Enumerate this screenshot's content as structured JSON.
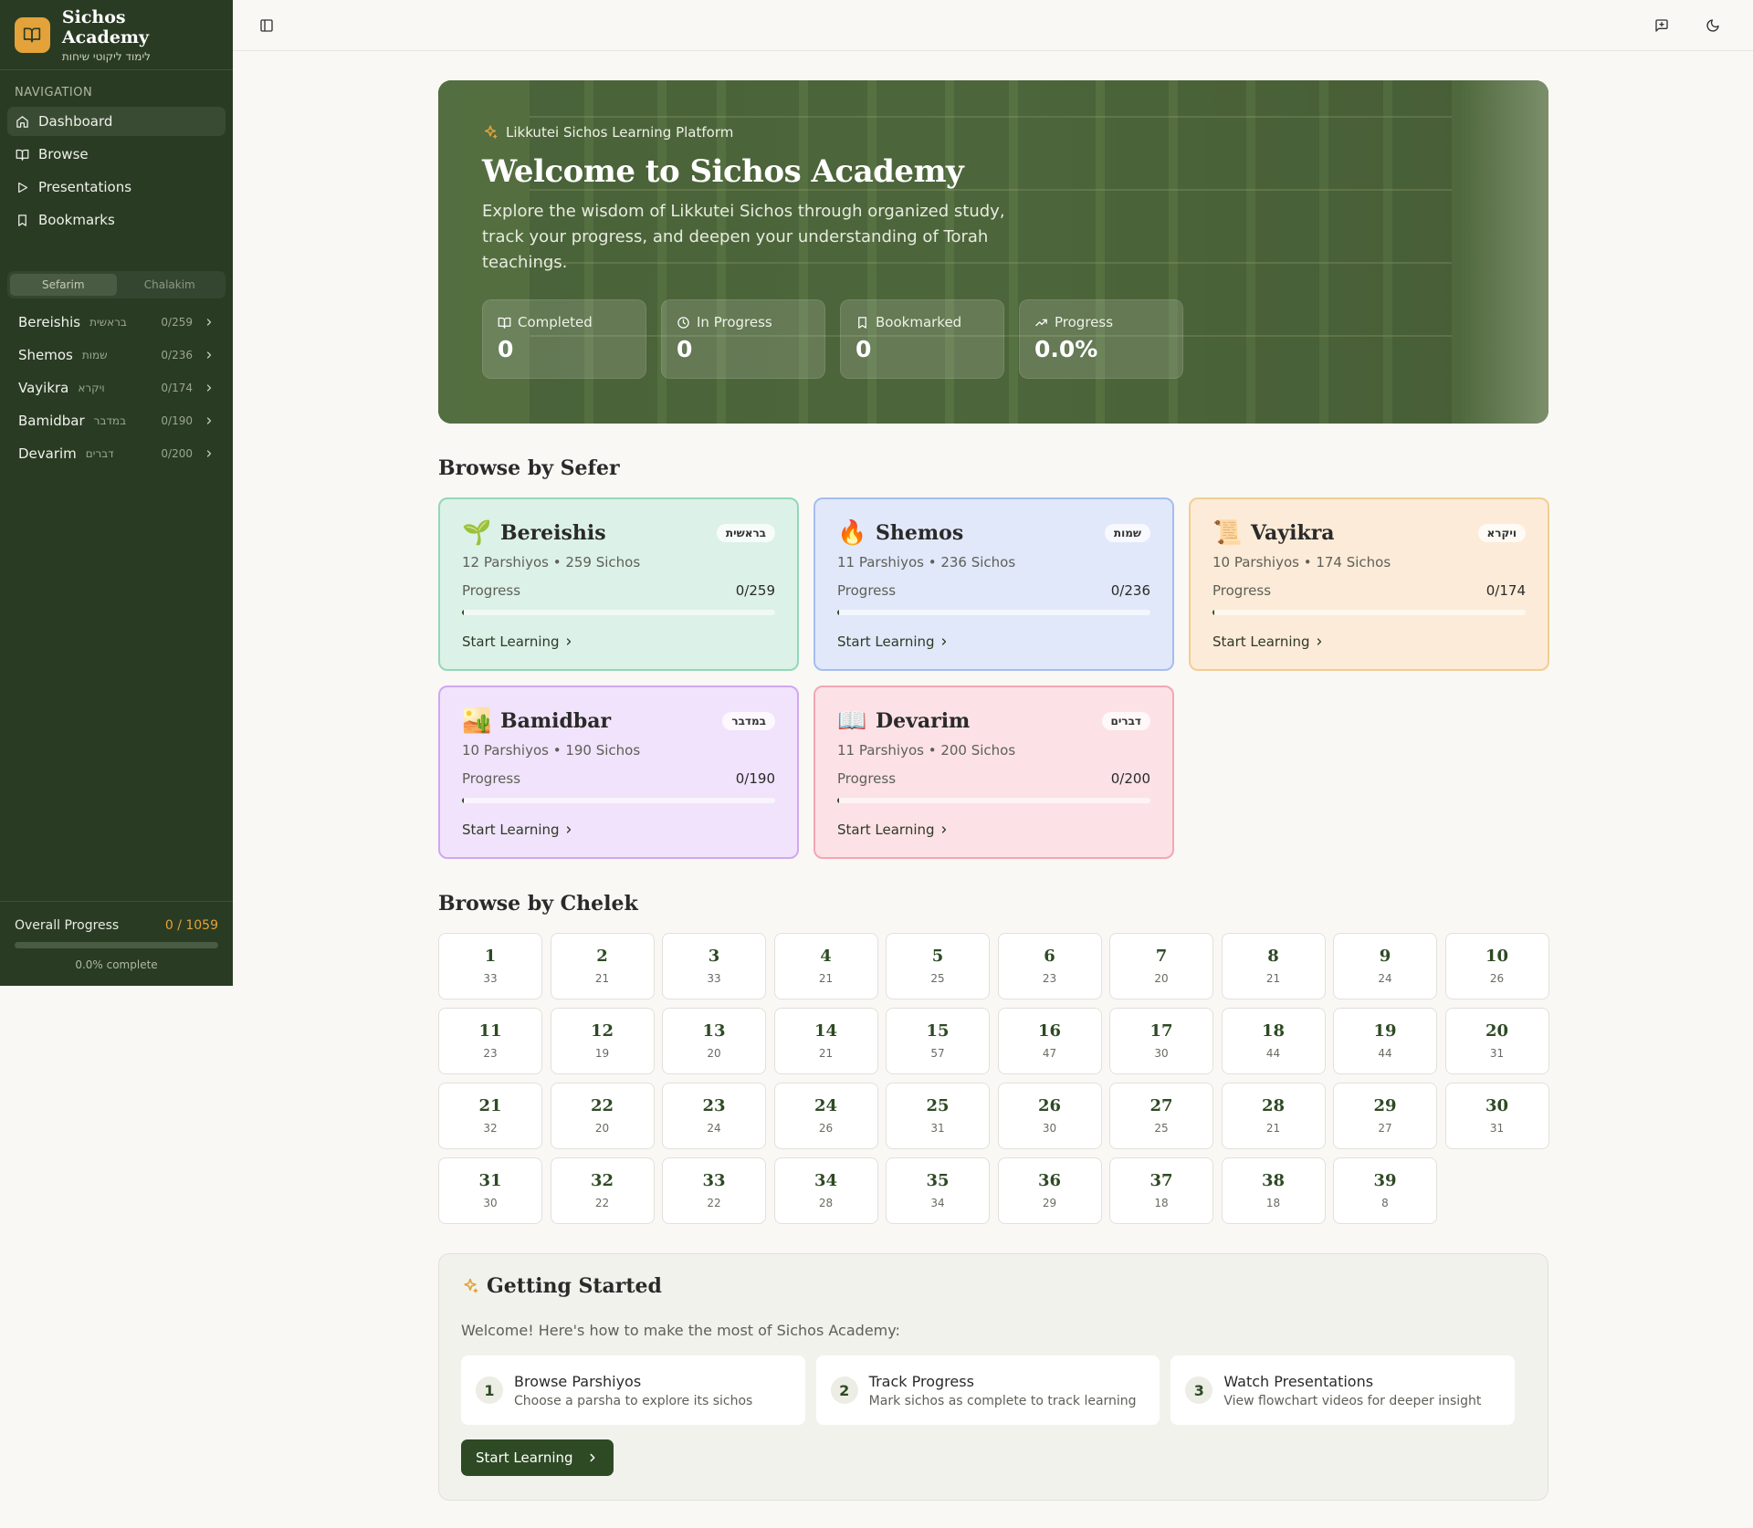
{
  "brand": {
    "title": "Sichos Academy",
    "subtitle": "לימוד ליקוטי שיחות"
  },
  "nav": {
    "heading": "NAVIGATION",
    "items": [
      {
        "label": "Dashboard",
        "icon": "home-icon"
      },
      {
        "label": "Browse",
        "icon": "book-open-icon"
      },
      {
        "label": "Presentations",
        "icon": "play-icon"
      },
      {
        "label": "Bookmarks",
        "icon": "bookmark-icon"
      }
    ]
  },
  "toggle": {
    "sefarim": "Sefarim",
    "chalakim": "Chalakim"
  },
  "sidebar_sefarim": [
    {
      "name": "Bereishis",
      "hebrew": "בראשית",
      "count": "0/259"
    },
    {
      "name": "Shemos",
      "hebrew": "שמות",
      "count": "0/236"
    },
    {
      "name": "Vayikra",
      "hebrew": "ויקרא",
      "count": "0/174"
    },
    {
      "name": "Bamidbar",
      "hebrew": "במדבר",
      "count": "0/190"
    },
    {
      "name": "Devarim",
      "hebrew": "דברים",
      "count": "0/200"
    }
  ],
  "overall": {
    "label": "Overall Progress",
    "value": "0 / 1059",
    "percent_text": "0.0% complete",
    "fraction": 0
  },
  "hero": {
    "tag": "Likkutei Sichos Learning Platform",
    "title": "Welcome to Sichos Academy",
    "description": "Explore the wisdom of Likkutei Sichos through organized study, track your progress, and deepen your understanding of Torah teachings.",
    "stats": [
      {
        "label": "Completed",
        "value": "0",
        "icon": "book-icon"
      },
      {
        "label": "In Progress",
        "value": "0",
        "icon": "clock-icon"
      },
      {
        "label": "Bookmarked",
        "value": "0",
        "icon": "bookmark-icon"
      },
      {
        "label": "Progress",
        "value": "0.0%",
        "icon": "trending-up-icon"
      }
    ]
  },
  "browse_sefer": {
    "title": "Browse by Sefer",
    "progress_label": "Progress",
    "cta": "Start Learning",
    "cards": [
      {
        "name": "Bereishis",
        "hebrew": "בראשית",
        "emoji": "🌱",
        "sub": "12 Parshiyos • 259 Sichos",
        "progress": "0/259",
        "fraction": 0,
        "bg": "#dcf1e8",
        "border": "#92d8b8"
      },
      {
        "name": "Shemos",
        "hebrew": "שמות",
        "emoji": "🔥",
        "sub": "11 Parshiyos • 236 Sichos",
        "progress": "0/236",
        "fraction": 0,
        "bg": "#e1e8f9",
        "border": "#a5bdf1"
      },
      {
        "name": "Vayikra",
        "hebrew": "ויקרא",
        "emoji": "📜",
        "sub": "10 Parshiyos • 174 Sichos",
        "progress": "0/174",
        "fraction": 0,
        "bg": "#fcebd8",
        "border": "#f3cd92"
      },
      {
        "name": "Bamidbar",
        "hebrew": "במדבר",
        "emoji": "🏜️",
        "sub": "10 Parshiyos • 190 Sichos",
        "progress": "0/190",
        "fraction": 0,
        "bg": "#f1e3fb",
        "border": "#cfa8f0"
      },
      {
        "name": "Devarim",
        "hebrew": "דברים",
        "emoji": "📖",
        "sub": "11 Parshiyos • 200 Sichos",
        "progress": "0/200",
        "fraction": 0,
        "bg": "#fce2e6",
        "border": "#f3a7b2"
      }
    ]
  },
  "browse_chelek": {
    "title": "Browse by Chelek",
    "items": [
      {
        "num": "1",
        "count": "33"
      },
      {
        "num": "2",
        "count": "21"
      },
      {
        "num": "3",
        "count": "33"
      },
      {
        "num": "4",
        "count": "21"
      },
      {
        "num": "5",
        "count": "25"
      },
      {
        "num": "6",
        "count": "23"
      },
      {
        "num": "7",
        "count": "20"
      },
      {
        "num": "8",
        "count": "21"
      },
      {
        "num": "9",
        "count": "24"
      },
      {
        "num": "10",
        "count": "26"
      },
      {
        "num": "11",
        "count": "23"
      },
      {
        "num": "12",
        "count": "19"
      },
      {
        "num": "13",
        "count": "20"
      },
      {
        "num": "14",
        "count": "21"
      },
      {
        "num": "15",
        "count": "57"
      },
      {
        "num": "16",
        "count": "47"
      },
      {
        "num": "17",
        "count": "30"
      },
      {
        "num": "18",
        "count": "44"
      },
      {
        "num": "19",
        "count": "44"
      },
      {
        "num": "20",
        "count": "31"
      },
      {
        "num": "21",
        "count": "32"
      },
      {
        "num": "22",
        "count": "20"
      },
      {
        "num": "23",
        "count": "24"
      },
      {
        "num": "24",
        "count": "26"
      },
      {
        "num": "25",
        "count": "31"
      },
      {
        "num": "26",
        "count": "30"
      },
      {
        "num": "27",
        "count": "25"
      },
      {
        "num": "28",
        "count": "21"
      },
      {
        "num": "29",
        "count": "27"
      },
      {
        "num": "30",
        "count": "31"
      },
      {
        "num": "31",
        "count": "30"
      },
      {
        "num": "32",
        "count": "22"
      },
      {
        "num": "33",
        "count": "22"
      },
      {
        "num": "34",
        "count": "28"
      },
      {
        "num": "35",
        "count": "34"
      },
      {
        "num": "36",
        "count": "29"
      },
      {
        "num": "37",
        "count": "18"
      },
      {
        "num": "38",
        "count": "18"
      },
      {
        "num": "39",
        "count": "8"
      }
    ]
  },
  "getting_started": {
    "title": "Getting Started",
    "description": "Welcome! Here's how to make the most of Sichos Academy:",
    "steps": [
      {
        "num": "1",
        "title": "Browse Parshiyos",
        "desc": "Choose a parsha to explore its sichos"
      },
      {
        "num": "2",
        "title": "Track Progress",
        "desc": "Mark sichos as complete to track learning"
      },
      {
        "num": "3",
        "title": "Watch Presentations",
        "desc": "View flowchart videos for deeper insight"
      }
    ],
    "button": "Start Learning"
  },
  "colors": {
    "sidebar": "#2a3b23",
    "accent": "#e3a33a",
    "primary": "#2e4a24"
  }
}
